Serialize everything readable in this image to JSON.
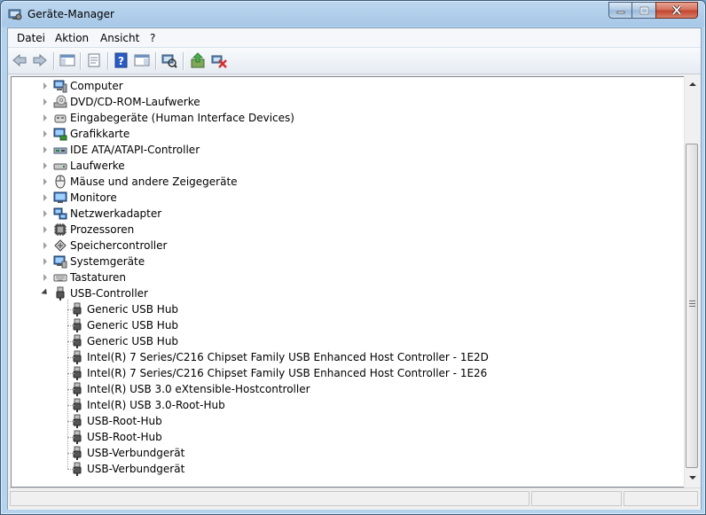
{
  "window": {
    "title": "Geräte-Manager"
  },
  "menubar": {
    "items": [
      "Datei",
      "Aktion",
      "Ansicht",
      "?"
    ]
  },
  "toolbar": {
    "buttons": [
      "back-icon",
      "forward-icon",
      "show-hide-console-tree-icon",
      "properties-icon",
      "help-icon",
      "action-pane-icon",
      "scan-hardware-icon",
      "update-driver-icon",
      "uninstall-icon"
    ]
  },
  "tree": {
    "categories": [
      {
        "label": "Computer",
        "icon": "computer-icon"
      },
      {
        "label": "DVD/CD-ROM-Laufwerke",
        "icon": "dvd-drive-icon"
      },
      {
        "label": "Eingabegeräte (Human Interface Devices)",
        "icon": "hid-icon"
      },
      {
        "label": "Grafikkarte",
        "icon": "display-adapter-icon"
      },
      {
        "label": "IDE ATA/ATAPI-Controller",
        "icon": "ide-controller-icon"
      },
      {
        "label": "Laufwerke",
        "icon": "disk-drive-icon"
      },
      {
        "label": "Mäuse und andere Zeigegeräte",
        "icon": "mouse-icon"
      },
      {
        "label": "Monitore",
        "icon": "monitor-icon"
      },
      {
        "label": "Netzwerkadapter",
        "icon": "network-adapter-icon"
      },
      {
        "label": "Prozessoren",
        "icon": "processor-icon"
      },
      {
        "label": "Speichercontroller",
        "icon": "storage-controller-icon"
      },
      {
        "label": "Systemgeräte",
        "icon": "system-devices-icon"
      },
      {
        "label": "Tastaturen",
        "icon": "keyboard-icon"
      }
    ],
    "expanded": {
      "label": "USB-Controller",
      "icon": "usb-connector-icon"
    },
    "usb_children": [
      "Generic USB Hub",
      "Generic USB Hub",
      "Generic USB Hub",
      "Intel(R) 7 Series/C216 Chipset Family USB Enhanced Host Controller - 1E2D",
      "Intel(R) 7 Series/C216 Chipset Family USB Enhanced Host Controller - 1E26",
      "Intel(R) USB 3.0 eXtensible-Hostcontroller",
      "Intel(R) USB 3.0-Root-Hub",
      "USB-Root-Hub",
      "USB-Root-Hub",
      "USB-Verbundgerät",
      "USB-Verbundgerät"
    ]
  },
  "colors": {
    "titlebar": "#a8c8e8",
    "close": "#c2412a",
    "selection": "#3399ff"
  }
}
